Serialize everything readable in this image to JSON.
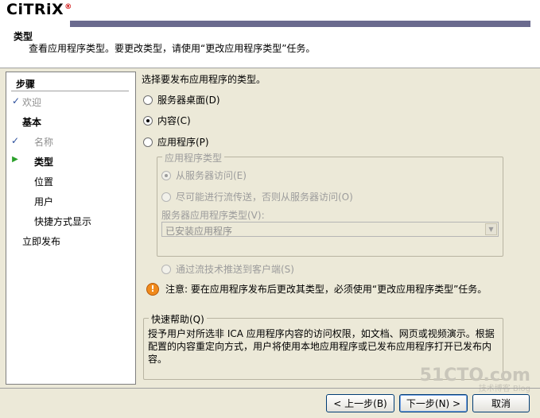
{
  "header": {
    "logo": "CiTRiX",
    "logo_mark": "®",
    "title": "类型",
    "description": "查看应用程序类型。要更改类型，请使用“更改应用程序类型”任务。"
  },
  "steps": {
    "heading": "步骤",
    "items": [
      {
        "label": "欢迎",
        "state": "done"
      },
      {
        "label": "基本",
        "state": "group"
      },
      {
        "label": "名称",
        "state": "done"
      },
      {
        "label": "类型",
        "state": "current"
      },
      {
        "label": "位置",
        "state": "pending"
      },
      {
        "label": "用户",
        "state": "pending"
      },
      {
        "label": "快捷方式显示",
        "state": "pending"
      },
      {
        "label": "立即发布",
        "state": "pending"
      }
    ]
  },
  "main": {
    "prompt": "选择要发布应用程序的类型。",
    "options": [
      {
        "label": "服务器桌面(D)",
        "selected": false
      },
      {
        "label": "内容(C)",
        "selected": true
      },
      {
        "label": "应用程序(P)",
        "selected": false
      }
    ],
    "app_type_group": {
      "title": "应用程序类型",
      "sub_options": [
        {
          "label": "从服务器访问(E)",
          "selected": true
        },
        {
          "label": "尽可能进行流传送，否则从服务器访问(O)",
          "selected": false
        }
      ],
      "server_app_type_label": "服务器应用程序类型(V):",
      "server_app_type_value": "已安装应用程序",
      "stream_option": "通过流技术推送到客户端(S)"
    },
    "notice": "注意: 要在应用程序发布后更改其类型，必须使用“更改应用程序类型”任务。",
    "quick_help": {
      "title": "快速帮助(Q)",
      "text": "授予用户对所选非 ICA 应用程序内容的访问权限，如文档、网页或视频演示。根据配置的内容重定向方式，用户将使用本地应用程序或已发布应用程序打开已发布内容。"
    }
  },
  "buttons": {
    "back": "< 上一步(B)",
    "next": "下一步(N) >",
    "cancel": "取消"
  },
  "watermark": {
    "line1": "51CTO.com",
    "line2": "技术博客 Blog"
  }
}
